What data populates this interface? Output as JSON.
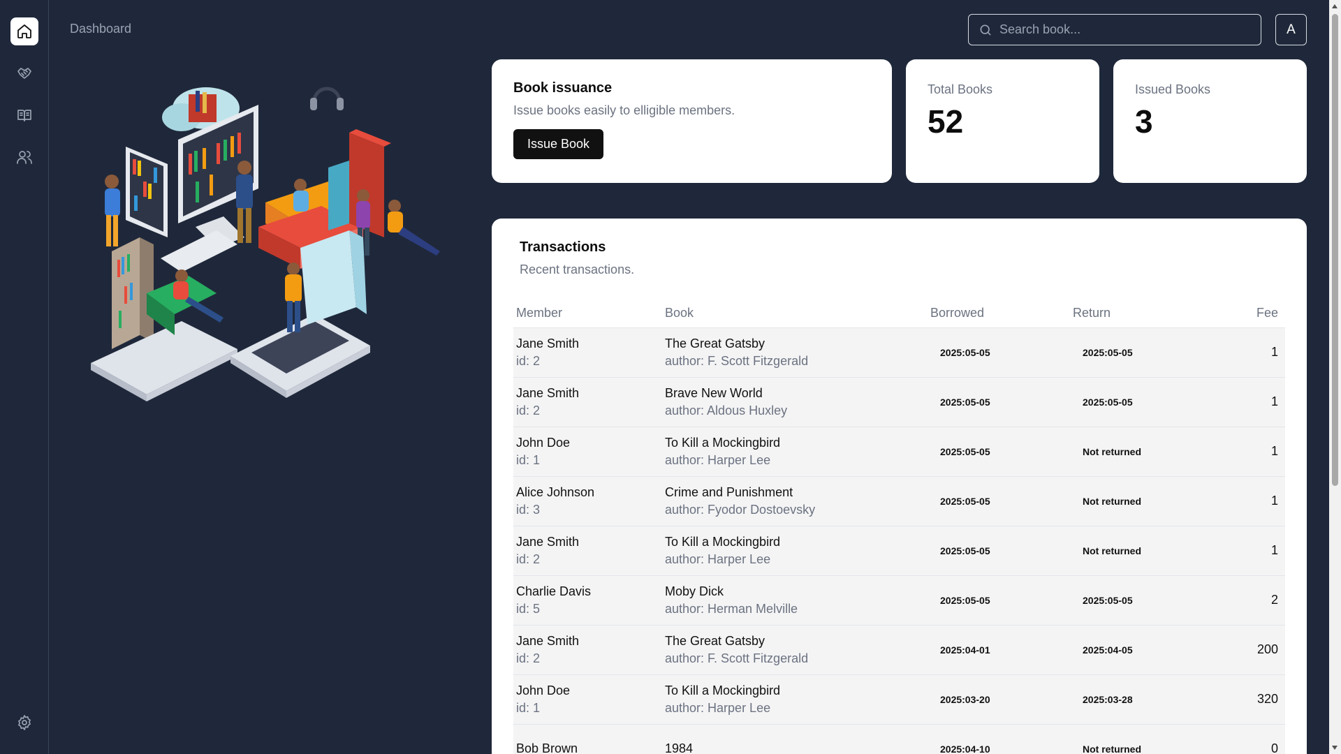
{
  "sidebar": {
    "items": [
      {
        "name": "home",
        "icon": "home-icon",
        "active": true
      },
      {
        "name": "transactions",
        "icon": "handshake-icon",
        "active": false
      },
      {
        "name": "books",
        "icon": "book-open-icon",
        "active": false
      },
      {
        "name": "members",
        "icon": "users-icon",
        "active": false
      }
    ],
    "settings_icon": "gear-icon"
  },
  "header": {
    "breadcrumb": "Dashboard",
    "search_placeholder": "Search book...",
    "avatar_label": "A"
  },
  "issuance": {
    "title": "Book issuance",
    "description": "Issue books easily to elligible members.",
    "button_label": "Issue Book"
  },
  "stats": {
    "total": {
      "label": "Total Books",
      "value": "52"
    },
    "issued": {
      "label": "Issued Books",
      "value": "3"
    }
  },
  "transactions": {
    "title": "Transactions",
    "subtitle": "Recent transactions.",
    "columns": [
      "Member",
      "Book",
      "Borrowed",
      "Return",
      "Fee"
    ],
    "rows": [
      {
        "member": "Jane Smith",
        "member_id": "id: 2",
        "book": "The Great Gatsby",
        "author": "author: F. Scott Fitzgerald",
        "borrowed": "2025:05-05",
        "return": "2025:05-05",
        "fee": "1"
      },
      {
        "member": "Jane Smith",
        "member_id": "id: 2",
        "book": "Brave New World",
        "author": "author: Aldous Huxley",
        "borrowed": "2025:05-05",
        "return": "2025:05-05",
        "fee": "1"
      },
      {
        "member": "John Doe",
        "member_id": "id: 1",
        "book": "To Kill a Mockingbird",
        "author": "author: Harper Lee",
        "borrowed": "2025:05-05",
        "return": "Not returned",
        "fee": "1"
      },
      {
        "member": "Alice Johnson",
        "member_id": "id: 3",
        "book": "Crime and Punishment",
        "author": "author: Fyodor Dostoevsky",
        "borrowed": "2025:05-05",
        "return": "Not returned",
        "fee": "1"
      },
      {
        "member": "Jane Smith",
        "member_id": "id: 2",
        "book": "To Kill a Mockingbird",
        "author": "author: Harper Lee",
        "borrowed": "2025:05-05",
        "return": "Not returned",
        "fee": "1"
      },
      {
        "member": "Charlie Davis",
        "member_id": "id: 5",
        "book": "Moby Dick",
        "author": "author: Herman Melville",
        "borrowed": "2025:05-05",
        "return": "2025:05-05",
        "fee": "2"
      },
      {
        "member": "Jane Smith",
        "member_id": "id: 2",
        "book": "The Great Gatsby",
        "author": "author: F. Scott Fitzgerald",
        "borrowed": "2025:04-01",
        "return": "2025:04-05",
        "fee": "200"
      },
      {
        "member": "John Doe",
        "member_id": "id: 1",
        "book": "To Kill a Mockingbird",
        "author": "author: Harper Lee",
        "borrowed": "2025:03-20",
        "return": "2025:03-28",
        "fee": "320"
      },
      {
        "member": "Bob Brown",
        "member_id": "",
        "book": "1984",
        "author": "",
        "borrowed": "2025:04-10",
        "return": "Not returned",
        "fee": "0"
      }
    ]
  },
  "colors": {
    "background": "#1f283a",
    "card": "#ffffff",
    "accent": "#111111",
    "muted": "#6b7280"
  }
}
